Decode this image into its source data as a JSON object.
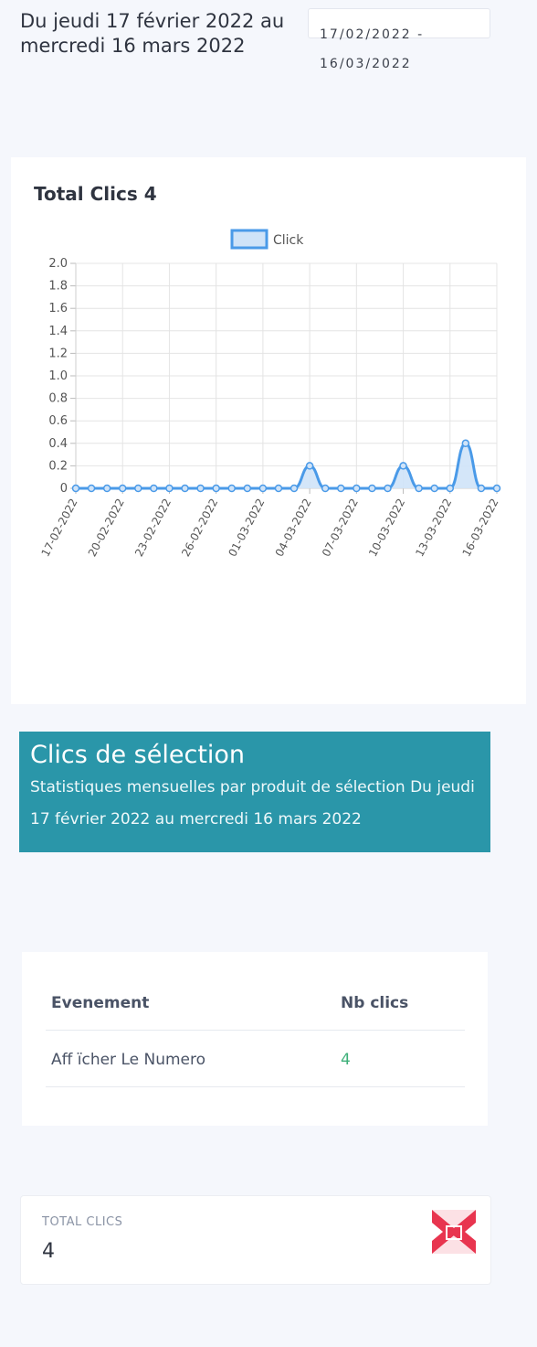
{
  "header": {
    "period_title": "Du jeudi 17 février 2022 au mercredi 16 mars 2022",
    "date_range_value": "17/02/2022 - 16/03/2022"
  },
  "chart_card": {
    "title": "Total Clics 4"
  },
  "chart_data": {
    "type": "line",
    "legend_position": "top",
    "grid": true,
    "ylim": [
      0,
      2.0
    ],
    "y_ticks": [
      "2.0",
      "1.8",
      "1.6",
      "1.4",
      "1.2",
      "1.0",
      "0.8",
      "0.6",
      "0.4",
      "0.2",
      "0"
    ],
    "x_tick_labels": [
      "17-02-2022",
      "20-02-2022",
      "23-02-2022",
      "26-02-2022",
      "01-03-2022",
      "04-03-2022",
      "07-03-2022",
      "10-03-2022",
      "13-03-2022",
      "16-03-2022"
    ],
    "x": [
      "17-02-2022",
      "18-02-2022",
      "19-02-2022",
      "20-02-2022",
      "21-02-2022",
      "22-02-2022",
      "23-02-2022",
      "24-02-2022",
      "25-02-2022",
      "26-02-2022",
      "27-02-2022",
      "28-02-2022",
      "01-03-2022",
      "02-03-2022",
      "03-03-2022",
      "04-03-2022",
      "05-03-2022",
      "06-03-2022",
      "07-03-2022",
      "08-03-2022",
      "09-03-2022",
      "10-03-2022",
      "11-03-2022",
      "12-03-2022",
      "13-03-2022",
      "14-03-2022",
      "15-03-2022",
      "16-03-2022"
    ],
    "series": [
      {
        "name": "Click",
        "color": "#4a9ae8",
        "fill": "#cfe3f8",
        "values": [
          0,
          0,
          0,
          0,
          0,
          0,
          0,
          0,
          0,
          0,
          0,
          0,
          0,
          0,
          0,
          0.2,
          0,
          0,
          0,
          0,
          0,
          0.2,
          0,
          0,
          0,
          0.4,
          0,
          0
        ]
      }
    ]
  },
  "banner": {
    "title": "Clics de sélection",
    "subtitle": "Statistiques mensuelles par produit de sélection Du jeudi 17 février 2022 au mercredi 16 mars 2022",
    "color": "#2a96a9"
  },
  "table": {
    "headers": [
      "Evenement",
      "Nb clics"
    ],
    "rows": [
      {
        "event": "Aff ïcher Le Numero",
        "clicks": "4"
      }
    ],
    "clicks_color": "#3fb07a"
  },
  "kpi": {
    "label": "TOTAL CLICS",
    "value": "4",
    "icon": "chart-trend-icon",
    "icon_color": "#e8354f"
  }
}
